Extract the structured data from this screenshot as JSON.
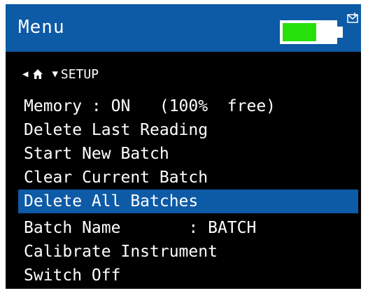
{
  "header": {
    "title": "Menu",
    "battery_level": 0.65,
    "colors": {
      "header_bg": "#0d5aa6",
      "battery_fill": "#26e00c"
    }
  },
  "nav": {
    "back_icon": "back-triangle-icon",
    "home_icon": "home-icon",
    "expand_icon": "chevron-down-icon",
    "section": "SETUP"
  },
  "menu": {
    "items": [
      {
        "label": "Memory : ON   (100%  free)"
      },
      {
        "label": "Delete Last Reading"
      },
      {
        "label": "Start New Batch"
      },
      {
        "label": "Clear Current Batch"
      },
      {
        "label": "Delete All Batches",
        "selected": true
      },
      {
        "label": "Batch Name       : BATCH"
      },
      {
        "label": "Calibrate Instrument"
      },
      {
        "label": "Switch Off"
      }
    ]
  }
}
